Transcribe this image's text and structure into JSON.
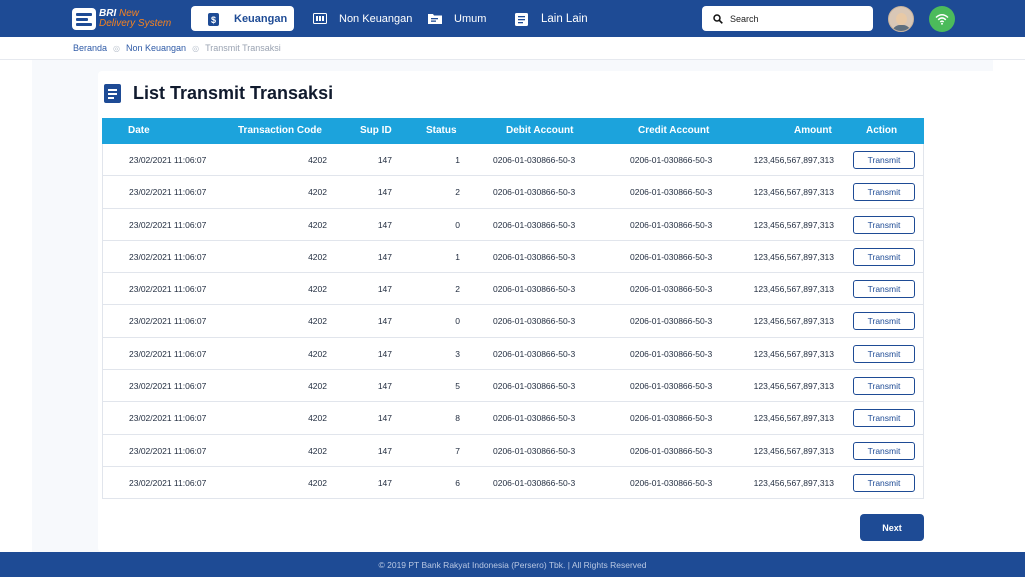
{
  "app": {
    "logo_line1": "BRI",
    "logo_line1_suffix": "New",
    "logo_line2": "Delivery System"
  },
  "nav": {
    "items": [
      {
        "label": "Keuangan",
        "icon": "dollar-icon",
        "active": true
      },
      {
        "label": "Non Keuangan",
        "icon": "card-icon",
        "active": false
      },
      {
        "label": "Umum",
        "icon": "folder-icon",
        "active": false
      },
      {
        "label": "Lain Lain",
        "icon": "document-icon",
        "active": false
      }
    ]
  },
  "search": {
    "placeholder": "Search"
  },
  "status": {
    "connection_icon": "wifi-icon",
    "connection_color": "#4cbb5b"
  },
  "breadcrumb": [
    "Beranda",
    "Non Keuangan",
    "Transmit Transaksi"
  ],
  "page": {
    "title": "List Transmit Transaksi"
  },
  "table": {
    "headers": {
      "date": "Date",
      "code": "Transaction Code",
      "sup": "Sup ID",
      "status": "Status",
      "debit": "Debit Account",
      "credit": "Credit Account",
      "amount": "Amount",
      "action": "Action"
    },
    "action_label": "Transmit",
    "rows": [
      {
        "date": "23/02/2021 11:06:07",
        "code": "4202",
        "sup": "147",
        "status": "1",
        "debit": "0206-01-030866-50-3",
        "credit": "0206-01-030866-50-3",
        "amount": "123,456,567,897,313"
      },
      {
        "date": "23/02/2021 11:06:07",
        "code": "4202",
        "sup": "147",
        "status": "2",
        "debit": "0206-01-030866-50-3",
        "credit": "0206-01-030866-50-3",
        "amount": "123,456,567,897,313"
      },
      {
        "date": "23/02/2021 11:06:07",
        "code": "4202",
        "sup": "147",
        "status": "0",
        "debit": "0206-01-030866-50-3",
        "credit": "0206-01-030866-50-3",
        "amount": "123,456,567,897,313"
      },
      {
        "date": "23/02/2021 11:06:07",
        "code": "4202",
        "sup": "147",
        "status": "1",
        "debit": "0206-01-030866-50-3",
        "credit": "0206-01-030866-50-3",
        "amount": "123,456,567,897,313"
      },
      {
        "date": "23/02/2021 11:06:07",
        "code": "4202",
        "sup": "147",
        "status": "2",
        "debit": "0206-01-030866-50-3",
        "credit": "0206-01-030866-50-3",
        "amount": "123,456,567,897,313"
      },
      {
        "date": "23/02/2021 11:06:07",
        "code": "4202",
        "sup": "147",
        "status": "0",
        "debit": "0206-01-030866-50-3",
        "credit": "0206-01-030866-50-3",
        "amount": "123,456,567,897,313"
      },
      {
        "date": "23/02/2021 11:06:07",
        "code": "4202",
        "sup": "147",
        "status": "3",
        "debit": "0206-01-030866-50-3",
        "credit": "0206-01-030866-50-3",
        "amount": "123,456,567,897,313"
      },
      {
        "date": "23/02/2021 11:06:07",
        "code": "4202",
        "sup": "147",
        "status": "5",
        "debit": "0206-01-030866-50-3",
        "credit": "0206-01-030866-50-3",
        "amount": "123,456,567,897,313"
      },
      {
        "date": "23/02/2021 11:06:07",
        "code": "4202",
        "sup": "147",
        "status": "8",
        "debit": "0206-01-030866-50-3",
        "credit": "0206-01-030866-50-3",
        "amount": "123,456,567,897,313"
      },
      {
        "date": "23/02/2021 11:06:07",
        "code": "4202",
        "sup": "147",
        "status": "7",
        "debit": "0206-01-030866-50-3",
        "credit": "0206-01-030866-50-3",
        "amount": "123,456,567,897,313"
      },
      {
        "date": "23/02/2021 11:06:07",
        "code": "4202",
        "sup": "147",
        "status": "6",
        "debit": "0206-01-030866-50-3",
        "credit": "0206-01-030866-50-3",
        "amount": "123,456,567,897,313"
      }
    ]
  },
  "actions": {
    "next_label": "Next"
  },
  "footer": {
    "text": "© 2019 PT Bank Rakyat Indonesia (Persero) Tbk. | All Rights Reserved"
  },
  "colors": {
    "primary": "#1e4b95",
    "table_header": "#1ca3dc",
    "accent": "#f58220"
  }
}
